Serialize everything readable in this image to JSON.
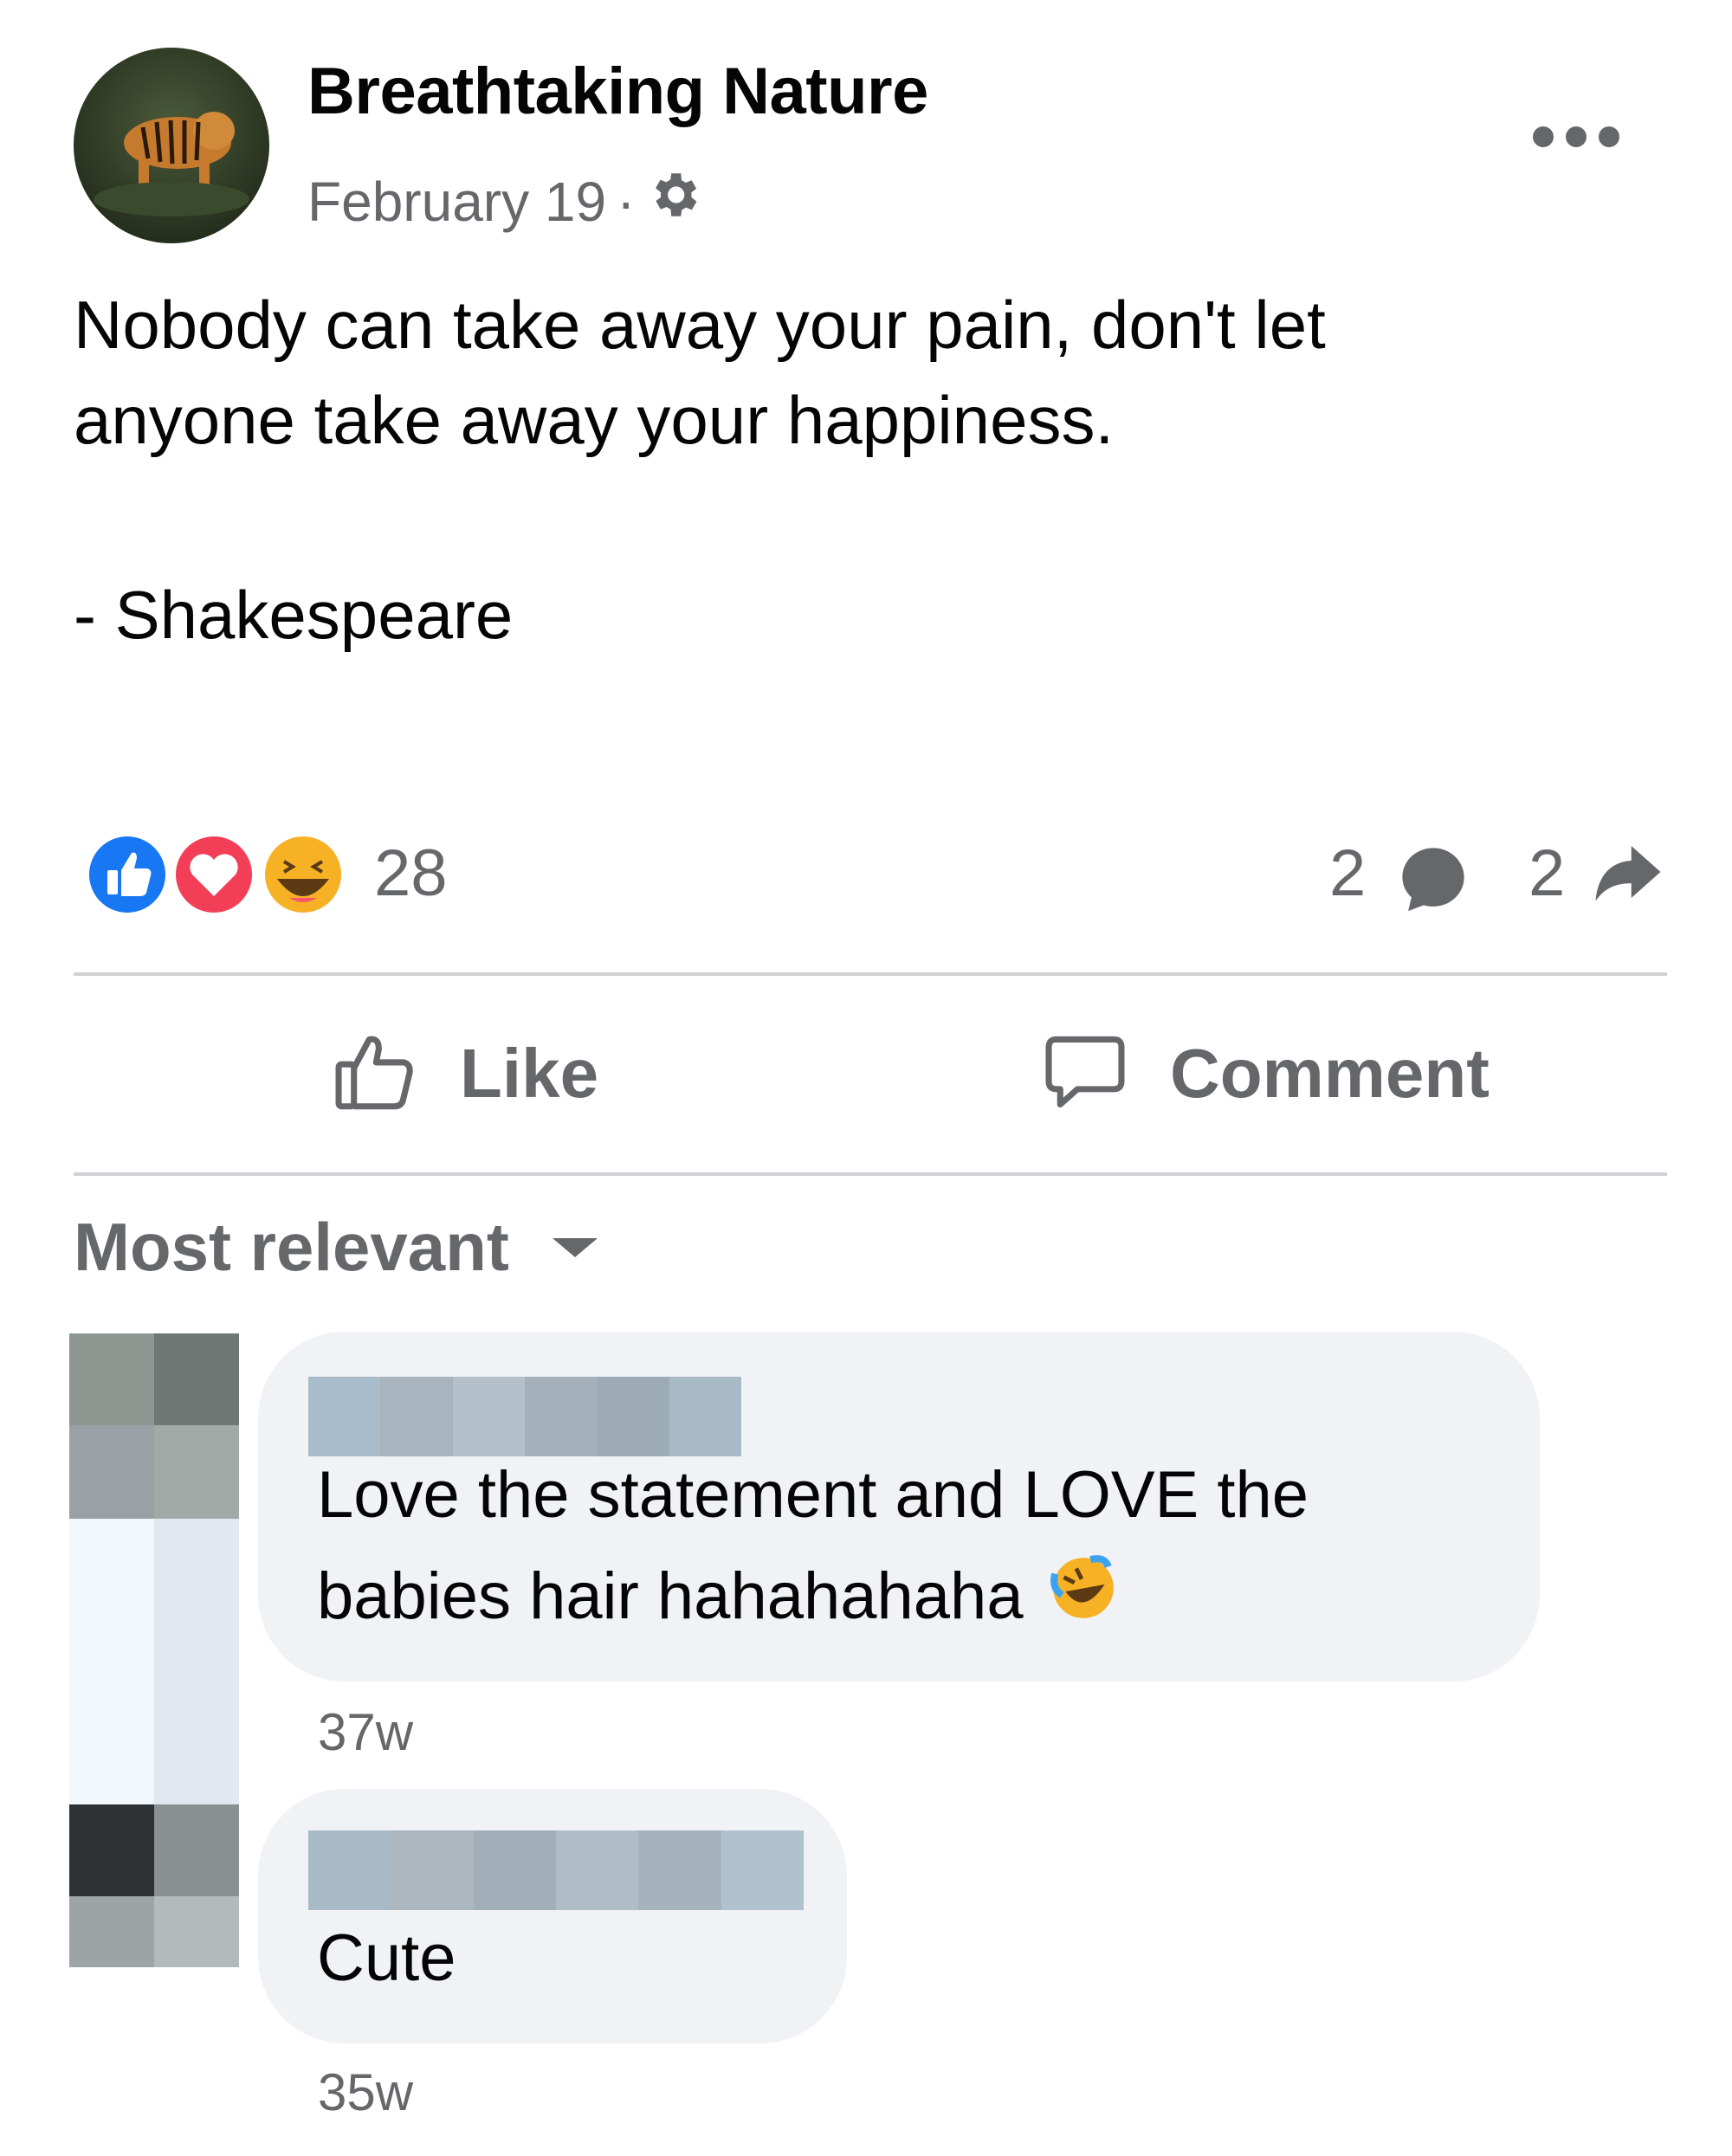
{
  "post": {
    "page_name": "Breathtaking Nature",
    "date": "February 19",
    "separator": "·",
    "text_lines": [
      "Nobody can take away your pain, don't let",
      "anyone take away your happiness.",
      "- Shakespeare"
    ],
    "more_icon": "more-horizontal-icon",
    "audience_icon": "gear-icon"
  },
  "stats": {
    "reactions": [
      "like-reaction-icon",
      "love-reaction-icon",
      "haha-reaction-icon"
    ],
    "reaction_count": "28",
    "comment_count": "2",
    "share_count": "2"
  },
  "actions": {
    "like_label": "Like",
    "comment_label": "Comment"
  },
  "sort": {
    "label": "Most relevant"
  },
  "comments": [
    {
      "lines": [
        "Love the statement and LOVE the",
        "babies hair hahahahaha"
      ],
      "emoji": "rolling-on-floor-laughing-icon",
      "time": "37w"
    },
    {
      "lines": [
        "Cute"
      ],
      "time": "35w"
    }
  ],
  "colors": {
    "text": "#050505",
    "secondary": "#65676b",
    "divider": "#ced0d4",
    "bubble": "#f0f2f5",
    "like_blue": "#1877f2",
    "love_red": "#f33e58",
    "haha_yellow": "#f7b125"
  }
}
